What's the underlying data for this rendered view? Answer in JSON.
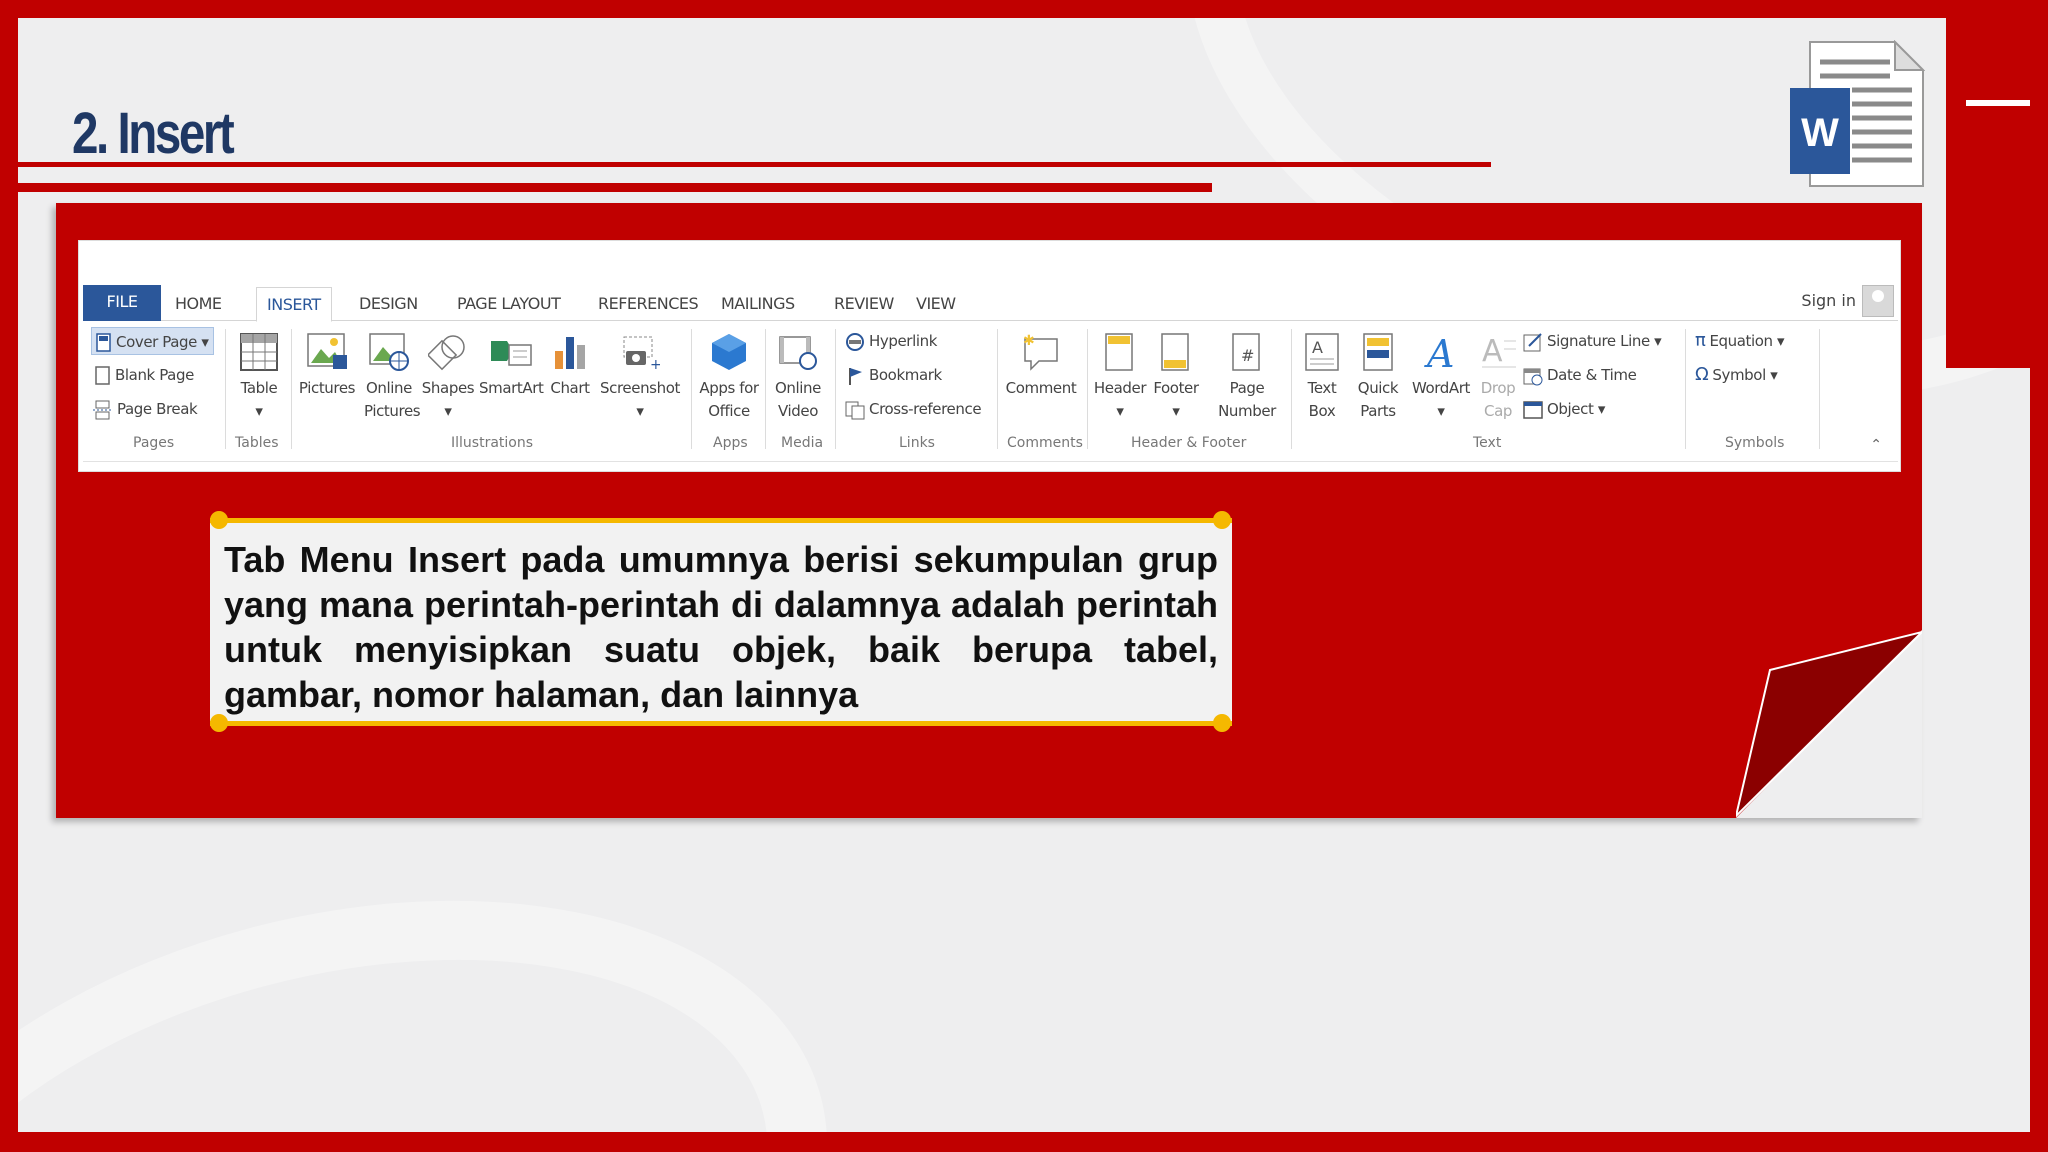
{
  "slide": {
    "title": "2. Insert",
    "callout_text": "Tab Menu Insert pada umumnya berisi sekumpulan grup yang mana perintah-perintah di dalamnya adalah perintah untuk menyisipkan suatu objek, baik berupa tabel, gambar, nomor halaman, dan lainnya",
    "logo_letter": "W"
  },
  "colors": {
    "brand_red": "#c00000",
    "title_navy": "#1f3864",
    "accent_yellow": "#f5b800",
    "word_blue": "#2b579a"
  },
  "ribbon": {
    "tabs": [
      "FILE",
      "HOME",
      "INSERT",
      "DESIGN",
      "PAGE LAYOUT",
      "REFERENCES",
      "MAILINGS",
      "REVIEW",
      "VIEW"
    ],
    "active_tab": "INSERT",
    "sign_in": "Sign in",
    "groups": {
      "pages": {
        "label": "Pages",
        "items": [
          "Cover Page",
          "Blank Page",
          "Page Break"
        ]
      },
      "tables": {
        "label": "Tables",
        "items": [
          "Table"
        ]
      },
      "illustrations": {
        "label": "Illustrations",
        "items": [
          "Pictures",
          "Online Pictures",
          "Shapes",
          "SmartArt",
          "Chart",
          "Screenshot"
        ]
      },
      "apps": {
        "label": "Apps",
        "items": [
          "Apps for Office"
        ]
      },
      "media": {
        "label": "Media",
        "items": [
          "Online Video"
        ]
      },
      "links": {
        "label": "Links",
        "items": [
          "Hyperlink",
          "Bookmark",
          "Cross-reference"
        ]
      },
      "comments": {
        "label": "Comments",
        "items": [
          "Comment"
        ]
      },
      "header_footer": {
        "label": "Header & Footer",
        "items": [
          "Header",
          "Footer",
          "Page Number"
        ]
      },
      "text": {
        "label": "Text",
        "items": [
          "Text Box",
          "Quick Parts",
          "WordArt",
          "Drop Cap",
          "Signature Line",
          "Date & Time",
          "Object"
        ]
      },
      "symbols": {
        "label": "Symbols",
        "items": [
          "Equation",
          "Symbol"
        ]
      }
    }
  }
}
